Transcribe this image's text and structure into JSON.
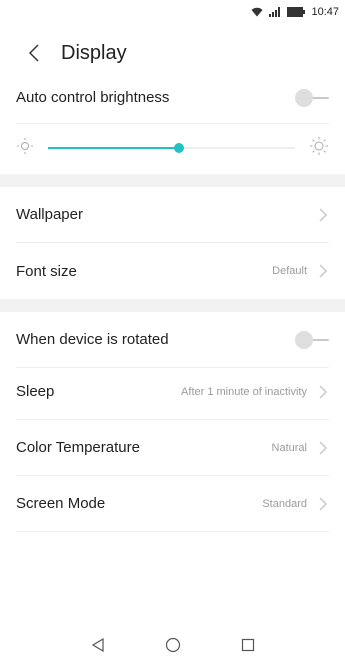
{
  "status_bar": {
    "time": "10:47",
    "icons": [
      "wifi-icon",
      "signal-icon",
      "battery-icon"
    ]
  },
  "header": {
    "title": "Display",
    "back_icon": "chevron-left-icon"
  },
  "brightness": {
    "auto_label": "Auto control brightness",
    "auto_enabled": false,
    "level": 0.53,
    "low_icon": "sun-low-icon",
    "high_icon": "sun-high-icon",
    "accent_color": "#22c1c3"
  },
  "section2": {
    "wallpaper_label": "Wallpaper",
    "font_size_label": "Font size",
    "font_size_value": "Default"
  },
  "section3": {
    "rotation_label": "When device is rotated",
    "rotation_enabled": false,
    "sleep_label": "Sleep",
    "sleep_value": "After 1 minute of inactivity",
    "color_temp_label": "Color Temperature",
    "color_temp_value": "Natural",
    "screen_mode_label": "Screen Mode",
    "screen_mode_value": "Standard"
  },
  "nav": {
    "back": "back-triangle-icon",
    "home": "home-circle-icon",
    "recents": "recents-square-icon"
  }
}
